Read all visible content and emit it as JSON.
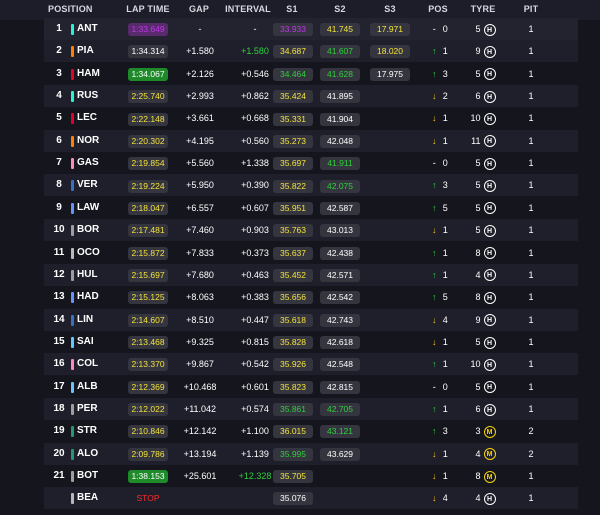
{
  "headers": {
    "position": "POSITION",
    "lap_time": "LAP TIME",
    "gap": "GAP",
    "interval": "INTERVAL",
    "s1": "S1",
    "s2": "S2",
    "s3": "S3",
    "pos": "POS",
    "tyre": "TYRE",
    "pit": "PIT"
  },
  "colors": {
    "purple": "#c038e8",
    "green": "#2ed03a",
    "yellow": "#f3e33b",
    "red": "#ff2a2a",
    "background": "#15151e",
    "row_alt": "#1f1f2b",
    "medium_tyre": "#f5d20a",
    "hard_tyre": "#ffffff"
  },
  "rows": [
    {
      "pos": "1",
      "driver": "ANT",
      "team_color": "#27f4d2",
      "lap": "1:33.649",
      "lap_c": "purple",
      "lap_bg": "#5a2a6e",
      "gap": "-",
      "interval": "-",
      "interval_c": "white",
      "s1": "33.933",
      "s1_c": "purple",
      "s2": "41.745",
      "s2_c": "yellow",
      "s3": "17.971",
      "s3_c": "yellow",
      "dir": "same",
      "pos_change": "0",
      "tyre_laps": "5",
      "tyre": "H",
      "pit": "1"
    },
    {
      "pos": "2",
      "driver": "PIA",
      "team_color": "#ff8000",
      "lap": "1:34.314",
      "lap_c": "white",
      "lap_bg": "#35353f",
      "gap": "+1.580",
      "interval": "+1.580",
      "interval_c": "green",
      "s1": "34.687",
      "s1_c": "yellow",
      "s2": "41.607",
      "s2_c": "green",
      "s3": "18.020",
      "s3_c": "yellow",
      "dir": "up",
      "pos_change": "1",
      "tyre_laps": "9",
      "tyre": "H",
      "pit": "1"
    },
    {
      "pos": "3",
      "driver": "HAM",
      "team_color": "#e8002d",
      "lap": "1:34.067",
      "lap_c": "white",
      "lap_bg": "#1f8a2a",
      "gap": "+2.126",
      "interval": "+0.546",
      "interval_c": "white",
      "s1": "34.464",
      "s1_c": "green",
      "s2": "41.628",
      "s2_c": "green",
      "s3": "17.975",
      "s3_c": "white",
      "dir": "up",
      "pos_change": "3",
      "tyre_laps": "5",
      "tyre": "H",
      "pit": "1"
    },
    {
      "pos": "4",
      "driver": "RUS",
      "team_color": "#27f4d2",
      "lap": "2:25.740",
      "lap_c": "yellow",
      "lap_bg": "#35353f",
      "gap": "+2.993",
      "interval": "+0.862",
      "interval_c": "white",
      "s1": "35.424",
      "s1_c": "yellow",
      "s2": "41.895",
      "s2_c": "white",
      "s3": "",
      "s3_c": "white",
      "dir": "down",
      "pos_change": "2",
      "tyre_laps": "6",
      "tyre": "H",
      "pit": "1"
    },
    {
      "pos": "5",
      "driver": "LEC",
      "team_color": "#e8002d",
      "lap": "2:22.148",
      "lap_c": "yellow",
      "lap_bg": "#35353f",
      "gap": "+3.661",
      "interval": "+0.668",
      "interval_c": "white",
      "s1": "35.331",
      "s1_c": "yellow",
      "s2": "41.904",
      "s2_c": "white",
      "s3": "",
      "s3_c": "white",
      "dir": "down",
      "pos_change": "1",
      "tyre_laps": "10",
      "tyre": "H",
      "pit": "1"
    },
    {
      "pos": "6",
      "driver": "NOR",
      "team_color": "#ff8000",
      "lap": "2:20.302",
      "lap_c": "yellow",
      "lap_bg": "#35353f",
      "gap": "+4.195",
      "interval": "+0.560",
      "interval_c": "white",
      "s1": "35.273",
      "s1_c": "yellow",
      "s2": "42.048",
      "s2_c": "white",
      "s3": "",
      "s3_c": "white",
      "dir": "down",
      "pos_change": "1",
      "tyre_laps": "11",
      "tyre": "H",
      "pit": "1"
    },
    {
      "pos": "7",
      "driver": "GAS",
      "team_color": "#ff87bc",
      "lap": "2:19.854",
      "lap_c": "yellow",
      "lap_bg": "#35353f",
      "gap": "+5.560",
      "interval": "+1.338",
      "interval_c": "white",
      "s1": "35.697",
      "s1_c": "yellow",
      "s2": "41.911",
      "s2_c": "green",
      "s3": "",
      "s3_c": "white",
      "dir": "same",
      "pos_change": "0",
      "tyre_laps": "5",
      "tyre": "H",
      "pit": "1"
    },
    {
      "pos": "8",
      "driver": "VER",
      "team_color": "#3671c6",
      "lap": "2:19.224",
      "lap_c": "yellow",
      "lap_bg": "#35353f",
      "gap": "+5.950",
      "interval": "+0.390",
      "interval_c": "white",
      "s1": "35.822",
      "s1_c": "yellow",
      "s2": "42.075",
      "s2_c": "green",
      "s3": "",
      "s3_c": "white",
      "dir": "up",
      "pos_change": "3",
      "tyre_laps": "5",
      "tyre": "H",
      "pit": "1"
    },
    {
      "pos": "9",
      "driver": "LAW",
      "team_color": "#6692ff",
      "lap": "2:18.047",
      "lap_c": "yellow",
      "lap_bg": "#35353f",
      "gap": "+6.557",
      "interval": "+0.607",
      "interval_c": "white",
      "s1": "35.951",
      "s1_c": "yellow",
      "s2": "42.587",
      "s2_c": "white",
      "s3": "",
      "s3_c": "white",
      "dir": "up",
      "pos_change": "5",
      "tyre_laps": "5",
      "tyre": "H",
      "pit": "1"
    },
    {
      "pos": "10",
      "driver": "BOR",
      "team_color": "#9e9e9e",
      "lap": "2:17.481",
      "lap_c": "yellow",
      "lap_bg": "#35353f",
      "gap": "+7.460",
      "interval": "+0.903",
      "interval_c": "white",
      "s1": "35.763",
      "s1_c": "yellow",
      "s2": "43.013",
      "s2_c": "white",
      "s3": "",
      "s3_c": "white",
      "dir": "down",
      "pos_change": "1",
      "tyre_laps": "5",
      "tyre": "H",
      "pit": "1"
    },
    {
      "pos": "11",
      "driver": "OCO",
      "team_color": "#b6babd",
      "lap": "2:15.872",
      "lap_c": "yellow",
      "lap_bg": "#35353f",
      "gap": "+7.833",
      "interval": "+0.373",
      "interval_c": "white",
      "s1": "35.637",
      "s1_c": "yellow",
      "s2": "42.438",
      "s2_c": "white",
      "s3": "",
      "s3_c": "white",
      "dir": "up",
      "pos_change": "1",
      "tyre_laps": "8",
      "tyre": "H",
      "pit": "1"
    },
    {
      "pos": "12",
      "driver": "HUL",
      "team_color": "#9e9e9e",
      "lap": "2:15.697",
      "lap_c": "yellow",
      "lap_bg": "#35353f",
      "gap": "+7.680",
      "interval": "+0.463",
      "interval_c": "white",
      "s1": "35.452",
      "s1_c": "yellow",
      "s2": "42.571",
      "s2_c": "white",
      "s3": "",
      "s3_c": "white",
      "dir": "up",
      "pos_change": "1",
      "tyre_laps": "4",
      "tyre": "H",
      "pit": "1"
    },
    {
      "pos": "13",
      "driver": "HAD",
      "team_color": "#6692ff",
      "lap": "2:15.125",
      "lap_c": "yellow",
      "lap_bg": "#35353f",
      "gap": "+8.063",
      "interval": "+0.383",
      "interval_c": "white",
      "s1": "35.656",
      "s1_c": "yellow",
      "s2": "42.542",
      "s2_c": "white",
      "s3": "",
      "s3_c": "white",
      "dir": "up",
      "pos_change": "5",
      "tyre_laps": "8",
      "tyre": "H",
      "pit": "1"
    },
    {
      "pos": "14",
      "driver": "LIN",
      "team_color": "#3671c6",
      "lap": "2:14.607",
      "lap_c": "yellow",
      "lap_bg": "#35353f",
      "gap": "+8.510",
      "interval": "+0.447",
      "interval_c": "white",
      "s1": "35.618",
      "s1_c": "yellow",
      "s2": "42.743",
      "s2_c": "white",
      "s3": "",
      "s3_c": "white",
      "dir": "down",
      "pos_change": "4",
      "tyre_laps": "9",
      "tyre": "H",
      "pit": "1"
    },
    {
      "pos": "15",
      "driver": "SAI",
      "team_color": "#64c4ff",
      "lap": "2:13.468",
      "lap_c": "yellow",
      "lap_bg": "#35353f",
      "gap": "+9.325",
      "interval": "+0.815",
      "interval_c": "white",
      "s1": "35.828",
      "s1_c": "yellow",
      "s2": "42.618",
      "s2_c": "white",
      "s3": "",
      "s3_c": "white",
      "dir": "down",
      "pos_change": "1",
      "tyre_laps": "5",
      "tyre": "H",
      "pit": "1"
    },
    {
      "pos": "16",
      "driver": "COL",
      "team_color": "#ff87bc",
      "lap": "2:13.370",
      "lap_c": "yellow",
      "lap_bg": "#35353f",
      "gap": "+9.867",
      "interval": "+0.542",
      "interval_c": "white",
      "s1": "35.926",
      "s1_c": "yellow",
      "s2": "42.548",
      "s2_c": "white",
      "s3": "",
      "s3_c": "white",
      "dir": "up",
      "pos_change": "1",
      "tyre_laps": "10",
      "tyre": "H",
      "pit": "1"
    },
    {
      "pos": "17",
      "driver": "ALB",
      "team_color": "#64c4ff",
      "lap": "2:12.369",
      "lap_c": "yellow",
      "lap_bg": "#35353f",
      "gap": "+10.468",
      "interval": "+0.601",
      "interval_c": "white",
      "s1": "35.823",
      "s1_c": "yellow",
      "s2": "42.815",
      "s2_c": "white",
      "s3": "",
      "s3_c": "white",
      "dir": "same",
      "pos_change": "0",
      "tyre_laps": "5",
      "tyre": "H",
      "pit": "1"
    },
    {
      "pos": "18",
      "driver": "PER",
      "team_color": "#9e9e9e",
      "lap": "2:12.022",
      "lap_c": "yellow",
      "lap_bg": "#35353f",
      "gap": "+11.042",
      "interval": "+0.574",
      "interval_c": "white",
      "s1": "35.861",
      "s1_c": "green",
      "s2": "42.705",
      "s2_c": "green",
      "s3": "",
      "s3_c": "white",
      "dir": "up",
      "pos_change": "1",
      "tyre_laps": "6",
      "tyre": "H",
      "pit": "1"
    },
    {
      "pos": "19",
      "driver": "STR",
      "team_color": "#229971",
      "lap": "2:10.846",
      "lap_c": "yellow",
      "lap_bg": "#35353f",
      "gap": "+12.142",
      "interval": "+1.100",
      "interval_c": "white",
      "s1": "36.015",
      "s1_c": "yellow",
      "s2": "43.121",
      "s2_c": "green",
      "s3": "",
      "s3_c": "white",
      "dir": "up",
      "pos_change": "3",
      "tyre_laps": "3",
      "tyre": "M",
      "pit": "2"
    },
    {
      "pos": "20",
      "driver": "ALO",
      "team_color": "#229971",
      "lap": "2:09.786",
      "lap_c": "yellow",
      "lap_bg": "#35353f",
      "gap": "+13.194",
      "interval": "+1.139",
      "interval_c": "white",
      "s1": "35.995",
      "s1_c": "green",
      "s2": "43.629",
      "s2_c": "white",
      "s3": "",
      "s3_c": "white",
      "dir": "down",
      "pos_change": "1",
      "tyre_laps": "4",
      "tyre": "M",
      "pit": "2"
    },
    {
      "pos": "21",
      "driver": "BOT",
      "team_color": "#9e9e9e",
      "lap": "1:38.153",
      "lap_c": "white",
      "lap_bg": "#1f8a2a",
      "gap": "+25.601",
      "interval": "+12.328",
      "interval_c": "green",
      "s1": "35.705",
      "s1_c": "yellow",
      "s2": "",
      "s2_c": "white",
      "s3": "",
      "s3_c": "white",
      "dir": "down",
      "pos_change": "1",
      "tyre_laps": "8",
      "tyre": "M",
      "pit": "1"
    },
    {
      "pos": "",
      "driver": "BEA",
      "team_color": "#b6babd",
      "lap": "STOP",
      "lap_c": "red",
      "lap_bg": "transparent",
      "gap": "",
      "interval": "",
      "interval_c": "white",
      "s1": "35.076",
      "s1_c": "white",
      "s2": "",
      "s2_c": "white",
      "s3": "",
      "s3_c": "white",
      "dir": "down",
      "pos_change": "4",
      "tyre_laps": "4",
      "tyre": "H",
      "pit": "1"
    }
  ]
}
